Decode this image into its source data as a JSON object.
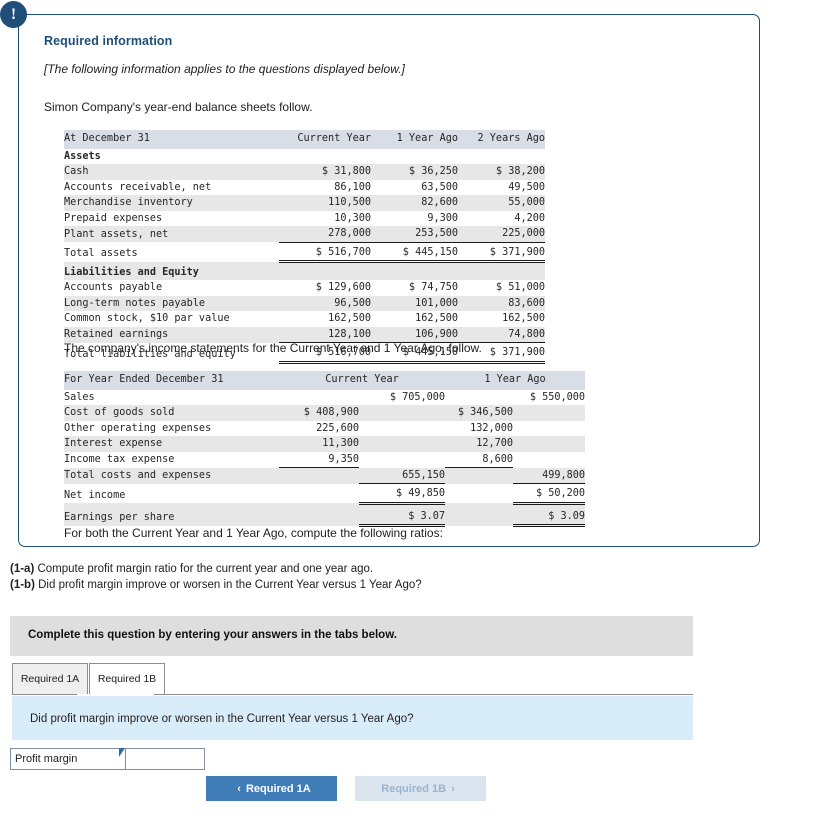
{
  "info_panel": {
    "badge": "!",
    "title": "Required information",
    "italic_note": "[The following information applies to the questions displayed below.]",
    "intro_line": "Simon Company's year-end balance sheets follow.",
    "income_intro": "The company's income statements for the Current Year and 1 Year Ago, follow.",
    "closing_line": "For both the Current Year and 1 Year Ago, compute the following ratios:"
  },
  "balance_sheet": {
    "columns": [
      "At December 31",
      "Current Year",
      "1 Year Ago",
      "2 Years Ago"
    ],
    "rows": [
      {
        "label": "Assets",
        "kind": "section",
        "values": [
          "",
          "",
          ""
        ]
      },
      {
        "label": "Cash",
        "kind": "item",
        "values": [
          "$ 31,800",
          "$ 36,250",
          "$ 38,200"
        ]
      },
      {
        "label": "Accounts receivable, net",
        "kind": "item",
        "values": [
          "86,100",
          "63,500",
          "49,500"
        ]
      },
      {
        "label": "Merchandise inventory",
        "kind": "item",
        "values": [
          "110,500",
          "82,600",
          "55,000"
        ]
      },
      {
        "label": "Prepaid expenses",
        "kind": "item",
        "values": [
          "10,300",
          "9,300",
          "4,200"
        ]
      },
      {
        "label": "Plant assets, net",
        "kind": "item-ruled",
        "values": [
          "278,000",
          "253,500",
          "225,000"
        ]
      },
      {
        "label": "Total assets",
        "kind": "total",
        "values": [
          "$ 516,700",
          "$ 445,150",
          "$ 371,900"
        ]
      },
      {
        "label": "Liabilities and Equity",
        "kind": "section",
        "values": [
          "",
          "",
          ""
        ]
      },
      {
        "label": "Accounts payable",
        "kind": "item",
        "values": [
          "$ 129,600",
          "$ 74,750",
          "$ 51,000"
        ]
      },
      {
        "label": "Long-term notes payable",
        "kind": "item",
        "values": [
          "96,500",
          "101,000",
          "83,600"
        ]
      },
      {
        "label": "Common stock, $10 par value",
        "kind": "item",
        "values": [
          "162,500",
          "162,500",
          "162,500"
        ]
      },
      {
        "label": "Retained earnings",
        "kind": "item-ruled",
        "values": [
          "128,100",
          "106,900",
          "74,800"
        ]
      },
      {
        "label": "Total liabilities and equity",
        "kind": "total",
        "values": [
          "$ 516,700",
          "$ 445,150",
          "$ 371,900"
        ]
      }
    ]
  },
  "income_statement": {
    "columns": [
      "For Year Ended December 31",
      "Current Year",
      "1 Year Ago"
    ],
    "rows": [
      {
        "label": "Sales",
        "kind": "item",
        "cy_sub": "",
        "cy_main": "$ 705,000",
        "py_sub": "",
        "py_main": "$ 550,000"
      },
      {
        "label": "Cost of goods sold",
        "kind": "item",
        "cy_sub": "$ 408,900",
        "cy_main": "",
        "py_sub": "$ 346,500",
        "py_main": ""
      },
      {
        "label": "Other operating expenses",
        "kind": "item",
        "cy_sub": "225,600",
        "cy_main": "",
        "py_sub": "132,000",
        "py_main": ""
      },
      {
        "label": "Interest expense",
        "kind": "item",
        "cy_sub": "11,300",
        "cy_main": "",
        "py_sub": "12,700",
        "py_main": ""
      },
      {
        "label": "Income tax expense",
        "kind": "item-ruled",
        "cy_sub": "9,350",
        "cy_main": "",
        "py_sub": "8,600",
        "py_main": ""
      },
      {
        "label": "Total costs and expenses",
        "kind": "subtotal",
        "cy_sub": "",
        "cy_main": "655,150",
        "py_sub": "",
        "py_main": "499,800"
      },
      {
        "label": "Net income",
        "kind": "total-dbl",
        "cy_sub": "",
        "cy_main": "$ 49,850",
        "py_sub": "",
        "py_main": "$ 50,200"
      },
      {
        "label": "Earnings per share",
        "kind": "eps-dbl",
        "cy_sub": "",
        "cy_main": "$ 3.07",
        "py_sub": "",
        "py_main": "$ 3.09"
      }
    ]
  },
  "questions": {
    "q1a_tag": "(1-a)",
    "q1a_text": "Compute profit margin ratio for the current year and one year ago.",
    "q1b_tag": "(1-b)",
    "q1b_text": "Did profit margin improve or worsen in the Current Year versus 1 Year Ago?"
  },
  "instruction_bar": {
    "text": "Complete this question by entering your answers in the tabs below."
  },
  "tabs": [
    {
      "label": "Required 1A",
      "active": false
    },
    {
      "label": "Required 1B",
      "active": true
    }
  ],
  "tab_panel": {
    "question": "Did profit margin improve or worsen in the Current Year versus 1 Year Ago?",
    "answer_row_label": "Profit margin",
    "answer_value": "",
    "answer_placeholder": ""
  },
  "nav": {
    "prev_label": "Required 1A",
    "prev_chevron": "‹",
    "next_label": "Required 1B",
    "next_chevron": "›"
  },
  "colors": {
    "panel_border": "#1f4e79",
    "heading": "#1f4e79",
    "table_header_bg": "#d9dde5",
    "row_shade": "#e7e7e7",
    "gray_bar": "#dedede",
    "banner_blue": "#d9ecf9",
    "btn_primary": "#3f7cb8",
    "btn_disabled": "#dae5ef"
  }
}
